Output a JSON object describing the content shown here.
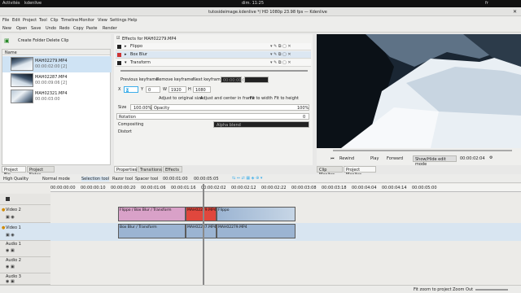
{
  "system": {
    "activities": "Activités",
    "app": "kdenlive",
    "clock": "dim. 11:25",
    "lang": "fr"
  },
  "window": {
    "title": "tutosideimage.kdenlive */ HD 1080p 23.98 fps — Kdenlive"
  },
  "menu": [
    "File",
    "Edit",
    "Project",
    "Tool",
    "Clip",
    "Timeline",
    "Monitor",
    "View",
    "Settings",
    "Help"
  ],
  "toolbar": {
    "new": "New",
    "open": "Open",
    "save": "Save",
    "undo": "Undo",
    "redo": "Redo",
    "copy": "Copy",
    "paste": "Paste",
    "render": "Render"
  },
  "bin": {
    "create_folder": "Create Folder",
    "delete_clip": "Delete Clip",
    "col_name": "Name",
    "items": [
      {
        "name": "MAH02279.MP4",
        "duration": "00:00:02:00 [2]"
      },
      {
        "name": "MAH02287.MP4",
        "duration": "00:00:09:06 [2]"
      },
      {
        "name": "MAH02321.MP4",
        "duration": "00:00:03:00"
      }
    ],
    "tab_bin": "Project Bin",
    "tab_notes": "Project Notes"
  },
  "effects": {
    "header": "Effects for MAH02279.MP4",
    "list": [
      "Flippo",
      "Box Blur",
      "Transform"
    ],
    "kf_prev": "Previous keyframe",
    "kf_remove": "Remove keyframe",
    "kf_next": "Next keyframe",
    "kf_time": "00:00:00:00",
    "x_label": "X",
    "x_val": "0",
    "y_label": "Y",
    "y_val": "0",
    "w_label": "W",
    "w_val": "1920",
    "h_label": "H",
    "h_val": "1080",
    "adjust_original": "Adjust to original size",
    "adjust_center": "Adjust and center in frame",
    "fit_width": "Fit to width",
    "fit_height": "Fit to height",
    "size_label": "Size",
    "size_val": "100.00%",
    "opacity_label": "Opacity",
    "opacity_val": "100%",
    "rotation_label": "Rotation",
    "rotation_val": "0",
    "compositing_label": "Compositing",
    "compositing_val": "Alpha blend",
    "distort_label": "Distort",
    "tabs": [
      "Properties",
      "Transitions",
      "Effects"
    ]
  },
  "monitor": {
    "rewind": "Rewind",
    "play": "Play",
    "forward": "Forward",
    "edit_mode": "Show/Hide edit mode",
    "timecode": "00:00:02:04",
    "tab_clip": "Clip Monitor",
    "tab_project": "Project Monitor"
  },
  "timeline": {
    "quality": "High Quality",
    "mode": "Normal mode",
    "selection": "Selection tool",
    "razor": "Razor tool",
    "spacer": "Spacer tool",
    "position": "00:00:01:00",
    "duration": "00:00:05:05",
    "ruler": [
      "00:00:00:00",
      "00:00:00:10",
      "00:00:00:20",
      "00:00:01:06",
      "00:00:01:16",
      "00:00:02:02",
      "00:00:02:12",
      "00:00:02:22",
      "00:00:03:08",
      "00:00:03:18",
      "00:00:04:04",
      "00:00:04:14",
      "00:00:05:00"
    ],
    "tracks": [
      "Video 2",
      "Video 1",
      "Audio 1",
      "Audio 2",
      "Audio 3"
    ],
    "clips": {
      "v2a": "Flippo / Box Blur / Transform",
      "v2b": "MAH02279.MP4",
      "v2c": "Flippo",
      "v1a": "Box Blur / Transform",
      "v1b": "MAH02287.MP4",
      "v1c": "MAH02279.MP4"
    },
    "zoom_label": "Zoom Out",
    "fit_zoom": "Fit zoom to project"
  },
  "colors": {
    "accent": "#3daee9",
    "clip_v2": "#d9a1c8",
    "clip_sel": "#e0473d",
    "clip_audio": "#9bb4d2",
    "playhead": "#888888"
  }
}
